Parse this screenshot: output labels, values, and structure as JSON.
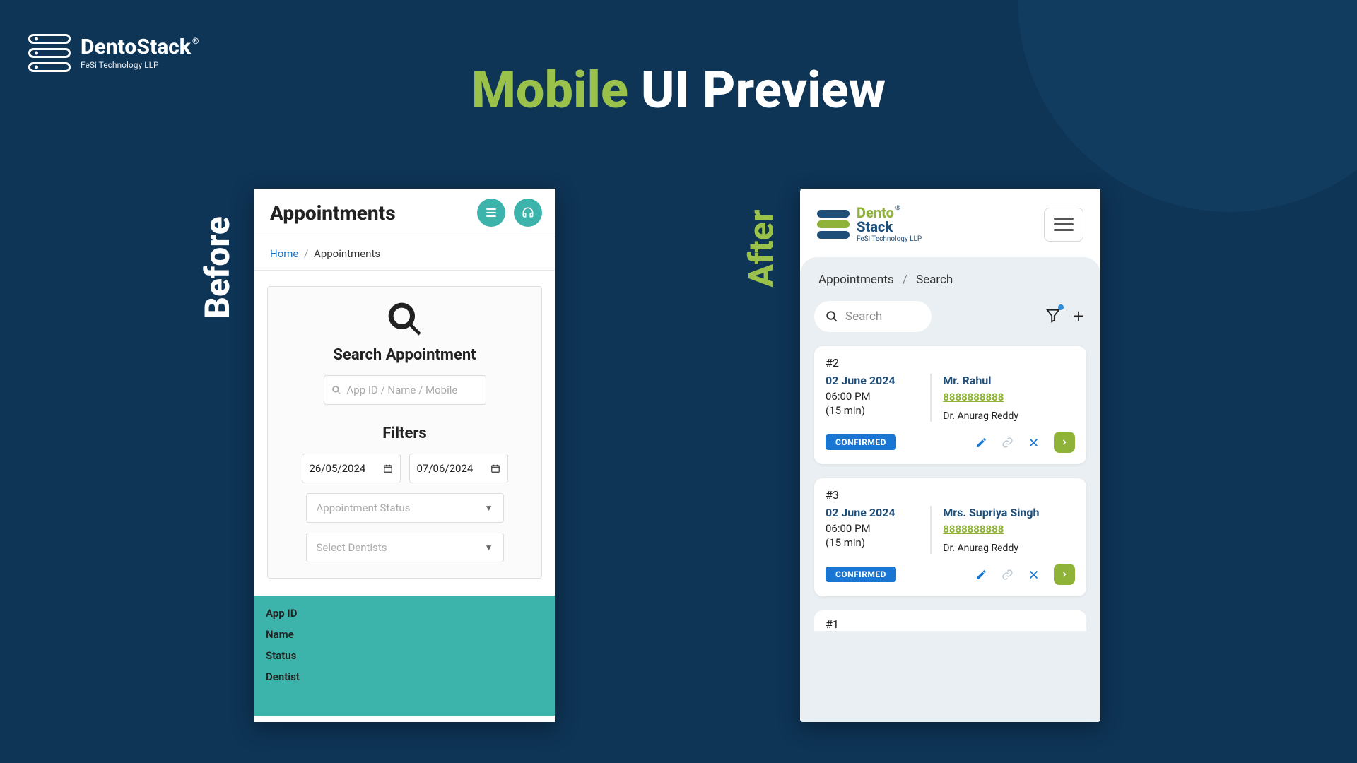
{
  "brand": {
    "name": "DentoStack",
    "registered": "®",
    "tag": "FeSi Technology LLP"
  },
  "title": {
    "accent": "Mobile",
    "rest": " UI Preview"
  },
  "labels": {
    "before": "Before",
    "after": "After"
  },
  "before": {
    "header": "Appointments",
    "breadcrumb": {
      "home": "Home",
      "current": "Appointments"
    },
    "search_label": "Search Appointment",
    "search_placeholder": "App ID / Name / Mobile",
    "filters_label": "Filters",
    "date_from": "26/05/2024",
    "date_to": "07/06/2024",
    "status_placeholder": "Appointment Status",
    "dentist_placeholder": "Select Dentists",
    "table_headers": [
      "App ID",
      "Name",
      "Status",
      "Dentist"
    ]
  },
  "after": {
    "logo": {
      "line1_a": "Dento",
      "line1_b": "",
      "line2": "Stack",
      "registered": "®",
      "tag": "FeSi Technology LLP"
    },
    "breadcrumb": {
      "a": "Appointments",
      "b": "Search"
    },
    "search_placeholder": "Search",
    "cards": [
      {
        "id": "#2",
        "date": "02 June 2024",
        "time": "06:00 PM",
        "duration": "(15 min)",
        "name": "Mr. Rahul",
        "phone": "8888888888",
        "doctor": "Dr. Anurag Reddy",
        "status": "CONFIRMED"
      },
      {
        "id": "#3",
        "date": "02 June 2024",
        "time": "06:00 PM",
        "duration": "(15 min)",
        "name": "Mrs. Supriya Singh",
        "phone": "8888888888",
        "doctor": "Dr. Anurag Reddy",
        "status": "CONFIRMED"
      }
    ],
    "partial_id": "#1"
  }
}
